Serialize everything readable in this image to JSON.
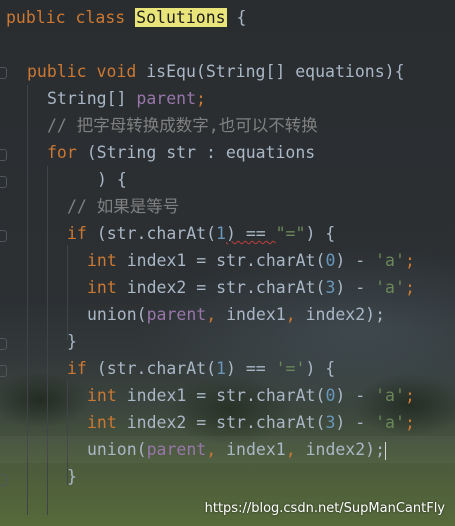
{
  "editor": {
    "class_decl": {
      "kw1": "public",
      "kw2": "class",
      "name": "Solutions",
      "brace": "{"
    },
    "method_decl": {
      "kw1": "public",
      "kw2": "void",
      "name": "isEqu",
      "params_open": "(String[] equations)",
      "brace": "{"
    },
    "field_decl": {
      "type": "String[]",
      "name": "parent",
      "semi": ";"
    },
    "comment1": "// 把字母转换成数字,也可以不转换",
    "for_line": {
      "kw": "for",
      "rest": " (String str : equations"
    },
    "for_close": ") {",
    "comment2": "// 如果是等号",
    "if1": {
      "kw": "if",
      "a": " (str.charAt(",
      "n": "1",
      "b": ") == ",
      "s": "\"=\"",
      "c": ") {"
    },
    "idx1a": {
      "kw": "int",
      "a": " index1 = str.charAt(",
      "n": "0",
      "b": ") - ",
      "s": "'a'",
      "semi": ";"
    },
    "idx2a": {
      "kw": "int",
      "a": " index2 = str.charAt(",
      "n": "3",
      "b": ") - ",
      "s": "'a'",
      "semi": ";"
    },
    "union1": {
      "a": "union(",
      "f": "parent",
      "c1": ",",
      "b": " index1",
      "c2": ",",
      "d": " index2);"
    },
    "close1": "}",
    "if2": {
      "kw": "if",
      "a": " (str.charAt(",
      "n": "1",
      "b": ") == ",
      "s": "'='",
      "c": ") {"
    },
    "idx1b": {
      "kw": "int",
      "a": " index1 = str.charAt(",
      "n": "0",
      "b": ") - ",
      "s": "'a'",
      "semi": ";"
    },
    "idx2b": {
      "kw": "int",
      "a": " index2 = str.charAt(",
      "n": "3",
      "b": ") - ",
      "s": "'a'",
      "semi": ";"
    },
    "union2": {
      "a": "union(",
      "f": "parent",
      "c1": ",",
      "b": " index1",
      "c2": ",",
      "d": " index2);"
    },
    "close2": "}"
  },
  "watermark": "https://blog.csdn.net/SupManCantFly",
  "colors": {
    "keyword": "#cc7832",
    "field": "#9876aa",
    "number": "#6897bb",
    "string": "#6a8759",
    "comment": "#808080",
    "text": "#a9b7c6",
    "highlight": "#eae57a"
  }
}
